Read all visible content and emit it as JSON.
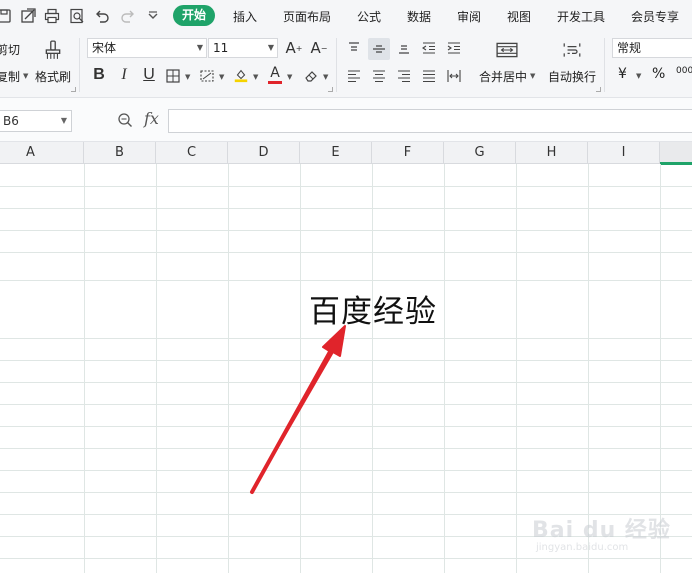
{
  "menu": {
    "tabs": [
      "开始",
      "插入",
      "页面布局",
      "公式",
      "数据",
      "审阅",
      "视图",
      "开发工具",
      "会员专享"
    ],
    "active_tab": "开始"
  },
  "ribbon": {
    "cut_label": "剪切",
    "copy_label": "复制",
    "format_painter_label": "格式刷",
    "font_name": "宋体",
    "font_size": "11",
    "merge_center_label": "合并居中",
    "wrap_text_label": "自动换行",
    "number_format": "常规",
    "currency_symbol": "¥",
    "percent_symbol": "%",
    "thousands_symbol": "000"
  },
  "formula_bar": {
    "name_box": "B6",
    "fx_label": "fx",
    "formula_value": ""
  },
  "grid": {
    "columns": [
      "A",
      "B",
      "C",
      "D",
      "E",
      "F",
      "G",
      "H",
      "I"
    ],
    "cell_text": "百度经验"
  },
  "watermark": {
    "brand": "Bai du 经验",
    "sub": "jingyan.baidu.com"
  },
  "colors": {
    "accent": "#1fa369",
    "arrow": "#e0242b",
    "font_color": "#e0242b",
    "highlight": "#f5d300"
  }
}
